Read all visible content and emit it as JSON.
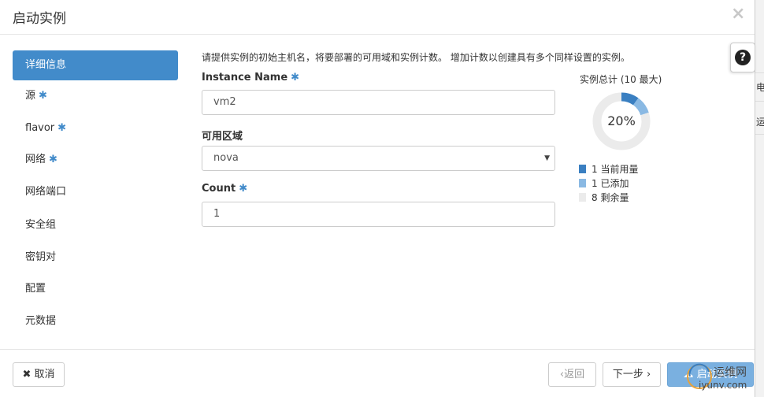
{
  "modal": {
    "title": "启动实例",
    "close": "×"
  },
  "help": {
    "label": "?"
  },
  "nav": [
    {
      "label": "详细信息",
      "required": false,
      "active": true
    },
    {
      "label": "源",
      "required": true,
      "active": false
    },
    {
      "label": "flavor",
      "required": true,
      "active": false
    },
    {
      "label": "网络",
      "required": true,
      "active": false
    },
    {
      "label": "网络端口",
      "required": false,
      "active": false
    },
    {
      "label": "安全组",
      "required": false,
      "active": false
    },
    {
      "label": "密钥对",
      "required": false,
      "active": false
    },
    {
      "label": "配置",
      "required": false,
      "active": false
    },
    {
      "label": "元数据",
      "required": false,
      "active": false
    }
  ],
  "required_marker": "✱",
  "form": {
    "description": "请提供实例的初始主机名，将要部署的可用域和实例计数。 增加计数以创建具有多个同样设置的实例。",
    "instance_name": {
      "label": "Instance Name",
      "value": "vm2"
    },
    "availability_zone": {
      "label": "可用区域",
      "value": "nova"
    },
    "count": {
      "label": "Count",
      "value": "1"
    }
  },
  "quota": {
    "title": "实例总计 (10 最大)",
    "percent_label": "20%",
    "max": 10,
    "items": [
      {
        "value": "1",
        "label": "当前用量",
        "color": "#3a7fc1"
      },
      {
        "value": "1",
        "label": "已添加",
        "color": "#8ab9e3"
      },
      {
        "value": "8",
        "label": "剩余量",
        "color": "#ebebeb"
      }
    ]
  },
  "footer": {
    "cancel": "取消",
    "back": "返回",
    "next": "下一步",
    "launch": "启动实例"
  },
  "watermark": {
    "line1": "运维网",
    "line2": "iyunv.com"
  },
  "background_page": {
    "chars": [
      "电",
      "运"
    ]
  }
}
